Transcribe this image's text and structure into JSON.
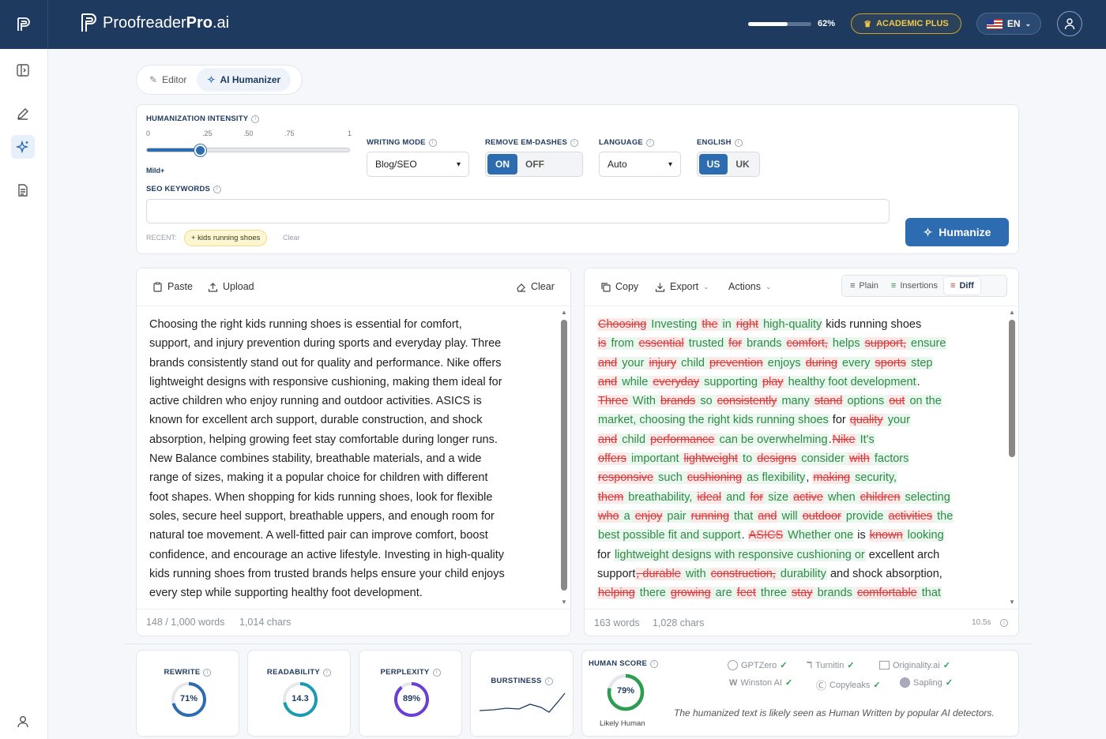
{
  "header": {
    "brand_regular": "Proofreader",
    "brand_bold": "Pro",
    "brand_suffix": ".ai",
    "usage_percent_label": "62%",
    "usage_fraction": 0.62,
    "plan_label": "ACADEMIC PLUS",
    "language_label": "EN"
  },
  "mode_tabs": {
    "editor": "Editor",
    "humanizer": "AI Humanizer"
  },
  "settings": {
    "intensity_label": "HUMANIZATION INTENSITY",
    "ticks": [
      "0",
      ".25",
      ".50",
      ".75",
      "1"
    ],
    "intensity_value": 0.27,
    "intensity_caption": "Mild+",
    "writing_mode_label": "WRITING MODE",
    "writing_mode_value": "Blog/SEO",
    "em_dash_label": "REMOVE EM-DASHES",
    "em_dash_on": "ON",
    "em_dash_off": "OFF",
    "language_label": "LANGUAGE",
    "language_value": "Auto",
    "english_label": "ENGLISH",
    "english_us": "US",
    "english_uk": "UK",
    "seo_label": "SEO KEYWORDS",
    "seo_value": "",
    "recent_label": "RECENT:",
    "recent_chip": "+ kids running shoes",
    "recent_clear": "Clear",
    "humanize_label": "Humanize"
  },
  "input_panel": {
    "paste": "Paste",
    "upload": "Upload",
    "clear": "Clear",
    "lines": [
      "Choosing the right kids running shoes is essential for comfort,",
      "support, and injury prevention during sports and everyday play. Three",
      "brands consistently stand out for quality and performance. Nike offers",
      "lightweight designs with responsive cushioning, making them ideal for",
      "active children who enjoy running and outdoor activities. ASICS is",
      "known for excellent arch support, durable construction, and shock",
      "absorption, helping growing feet stay comfortable during longer runs.",
      "New Balance combines stability, breathable materials, and a wide",
      "range of sizes, making it a popular choice for children with different",
      "foot shapes. When shopping for kids running shoes, look for flexible",
      "soles, secure heel support, breathable uppers, and enough room for",
      "natural toe movement. A well-fitted pair can improve comfort, boost",
      "confidence, and encourage an active lifestyle. Investing in high-quality",
      "kids running shoes from trusted brands helps ensure your child enjoys",
      "every step while supporting healthy foot development."
    ],
    "word_count": "148 / 1,000 words",
    "char_count": "1,014 chars"
  },
  "output_panel": {
    "copy": "Copy",
    "export": "Export",
    "actions": "Actions",
    "view_plain": "Plain",
    "view_insertions": "Insertions",
    "view_diff": "Diff",
    "lines": [
      [
        [
          "d",
          "Choosing"
        ],
        [
          "i",
          " Investing "
        ],
        [
          "d",
          "the"
        ],
        [
          "i",
          " in "
        ],
        [
          "d",
          "right"
        ],
        [
          "i",
          " high-quality"
        ],
        [
          "n",
          " kids running shoes"
        ]
      ],
      [
        [
          "d",
          "is"
        ],
        [
          "i",
          " from "
        ],
        [
          "d",
          "essential"
        ],
        [
          "i",
          " trusted "
        ],
        [
          "d",
          "for"
        ],
        [
          "i",
          " brands "
        ],
        [
          "d",
          "comfort,"
        ],
        [
          "i",
          " helps "
        ],
        [
          "d",
          "support,"
        ],
        [
          "i",
          " ensure"
        ]
      ],
      [
        [
          "d",
          "and"
        ],
        [
          "i",
          " your "
        ],
        [
          "d",
          "injury"
        ],
        [
          "i",
          " child "
        ],
        [
          "d",
          "prevention"
        ],
        [
          "i",
          " enjoys "
        ],
        [
          "d",
          "during"
        ],
        [
          "i",
          " every "
        ],
        [
          "d",
          "sports"
        ],
        [
          "i",
          " step"
        ]
      ],
      [
        [
          "d",
          "and"
        ],
        [
          "i",
          " while "
        ],
        [
          "d",
          "everyday"
        ],
        [
          "i",
          " supporting "
        ],
        [
          "d",
          "play"
        ],
        [
          "i",
          " healthy foot development"
        ],
        [
          "n",
          "."
        ]
      ],
      [
        [
          "d",
          "Three"
        ],
        [
          "i",
          " With "
        ],
        [
          "d",
          "brands"
        ],
        [
          "i",
          " so "
        ],
        [
          "d",
          "consistently"
        ],
        [
          "i",
          " many "
        ],
        [
          "d",
          "stand"
        ],
        [
          "i",
          " options "
        ],
        [
          "d",
          "out"
        ],
        [
          "i",
          " on the"
        ]
      ],
      [
        [
          "i",
          "market, choosing the right kids running shoes"
        ],
        [
          "n",
          " for "
        ],
        [
          "d",
          "quality"
        ],
        [
          "i",
          " your"
        ]
      ],
      [
        [
          "d",
          "and"
        ],
        [
          "i",
          " child "
        ],
        [
          "d",
          "performance"
        ],
        [
          "i",
          " can be overwhelming"
        ],
        [
          "n",
          "."
        ],
        [
          "d",
          "Nike"
        ],
        [
          "i",
          " It's"
        ]
      ],
      [
        [
          "d",
          "offers"
        ],
        [
          "i",
          " important "
        ],
        [
          "d",
          "lightweight"
        ],
        [
          "i",
          " to "
        ],
        [
          "d",
          "designs"
        ],
        [
          "i",
          " consider "
        ],
        [
          "d",
          "with"
        ],
        [
          "i",
          " factors"
        ]
      ],
      [
        [
          "d",
          "responsive"
        ],
        [
          "i",
          " such "
        ],
        [
          "d",
          "cushioning"
        ],
        [
          "i",
          " as flexibility"
        ],
        [
          "n",
          ", "
        ],
        [
          "d",
          "making"
        ],
        [
          "i",
          " security,"
        ]
      ],
      [
        [
          "d",
          "them"
        ],
        [
          "i",
          " breathability, "
        ],
        [
          "d",
          "ideal"
        ],
        [
          "i",
          " and "
        ],
        [
          "d",
          "for"
        ],
        [
          "i",
          " size "
        ],
        [
          "d",
          "active"
        ],
        [
          "i",
          " when "
        ],
        [
          "d",
          "children"
        ],
        [
          "i",
          " selecting"
        ]
      ],
      [
        [
          "d",
          "who"
        ],
        [
          "i",
          " a "
        ],
        [
          "d",
          "enjoy"
        ],
        [
          "i",
          " pair "
        ],
        [
          "d",
          "running"
        ],
        [
          "i",
          " that "
        ],
        [
          "d",
          "and"
        ],
        [
          "i",
          " will "
        ],
        [
          "d",
          "outdoor"
        ],
        [
          "i",
          " provide "
        ],
        [
          "d",
          "activities"
        ],
        [
          "i",
          " the"
        ]
      ],
      [
        [
          "i",
          "best possible fit and support"
        ],
        [
          "n",
          ". "
        ],
        [
          "d",
          "ASICS"
        ],
        [
          "i",
          " Whether one"
        ],
        [
          "n",
          " is "
        ],
        [
          "d",
          "known"
        ],
        [
          "i",
          " looking"
        ]
      ],
      [
        [
          "n",
          "for "
        ],
        [
          "i",
          "lightweight designs with responsive cushioning or"
        ],
        [
          "n",
          " excellent arch"
        ]
      ],
      [
        [
          "n",
          "support"
        ],
        [
          "d",
          ", durable"
        ],
        [
          "i",
          " with "
        ],
        [
          "d",
          "construction,"
        ],
        [
          "i",
          " durability"
        ],
        [
          "n",
          " and shock absorption,"
        ]
      ],
      [
        [
          "d",
          "helping"
        ],
        [
          "i",
          " there "
        ],
        [
          "d",
          "growing"
        ],
        [
          "i",
          " are "
        ],
        [
          "d",
          "feet"
        ],
        [
          "i",
          " three "
        ],
        [
          "d",
          "stay"
        ],
        [
          "i",
          " brands "
        ],
        [
          "d",
          "comfortable"
        ],
        [
          "i",
          " that"
        ]
      ]
    ],
    "word_count": "163 words",
    "char_count": "1,028 chars",
    "elapsed": "10.5s"
  },
  "metrics": {
    "rewrite_label": "REWRITE",
    "rewrite_value": "71%",
    "rewrite_fraction": 0.71,
    "readability_label": "READABILITY",
    "readability_value": "14.3",
    "readability_fraction": 0.72,
    "perplexity_label": "PERPLEXITY",
    "perplexity_value": "89%",
    "perplexity_fraction": 0.89,
    "burstiness_label": "BURSTINESS",
    "human_score_label": "HUMAN SCORE",
    "human_score_value": "79%",
    "human_score_fraction": 0.79,
    "human_score_caption": "Likely Human",
    "detectors": [
      "GPTZero",
      "Turnitin",
      "Originality.ai",
      "Winston AI",
      "Copyleaks",
      "Sapling"
    ],
    "summary": "The humanized text is likely seen as Human Written by popular AI detectors."
  },
  "colors": {
    "navy": "#1e3a5f",
    "primary": "#2d6cb0",
    "deleted": "#d93a3a",
    "inserted": "#2e8b46",
    "gold": "#c9a227"
  }
}
